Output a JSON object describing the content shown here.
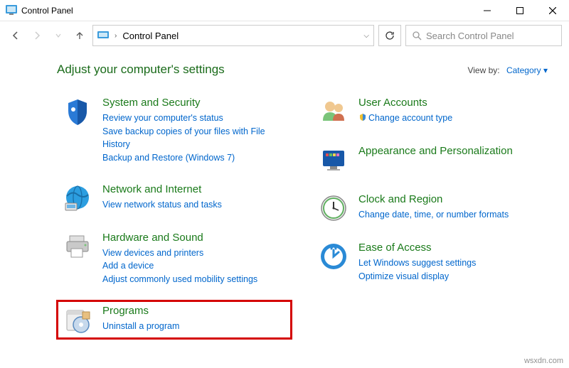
{
  "window": {
    "title": "Control Panel",
    "minimize": "—",
    "maximize": "▢",
    "close": "✕"
  },
  "toolbar": {
    "breadcrumb_root": "Control Panel",
    "search_placeholder": "Search Control Panel"
  },
  "header": {
    "title": "Adjust your computer's settings",
    "viewby_label": "View by:",
    "viewby_value": "Category ▾"
  },
  "categories": {
    "left": [
      {
        "icon": "shield-icon",
        "title": "System and Security",
        "links": [
          "Review your computer's status",
          "Save backup copies of your files with File History",
          "Backup and Restore (Windows 7)"
        ]
      },
      {
        "icon": "globe-icon",
        "title": "Network and Internet",
        "links": [
          "View network status and tasks"
        ]
      },
      {
        "icon": "printer-icon",
        "title": "Hardware and Sound",
        "links": [
          "View devices and printers",
          "Add a device",
          "Adjust commonly used mobility settings"
        ]
      },
      {
        "icon": "programs-icon",
        "title": "Programs",
        "links": [
          "Uninstall a program"
        ],
        "highlighted": true
      }
    ],
    "right": [
      {
        "icon": "users-icon",
        "title": "User Accounts",
        "links": [
          "Change account type"
        ],
        "link_prefix_icon": "shield-small-icon"
      },
      {
        "icon": "appearance-icon",
        "title": "Appearance and Personalization",
        "links": []
      },
      {
        "icon": "clock-icon",
        "title": "Clock and Region",
        "links": [
          "Change date, time, or number formats"
        ]
      },
      {
        "icon": "ease-icon",
        "title": "Ease of Access",
        "links": [
          "Let Windows suggest settings",
          "Optimize visual display"
        ]
      }
    ]
  },
  "watermark": "wsxdn.com"
}
